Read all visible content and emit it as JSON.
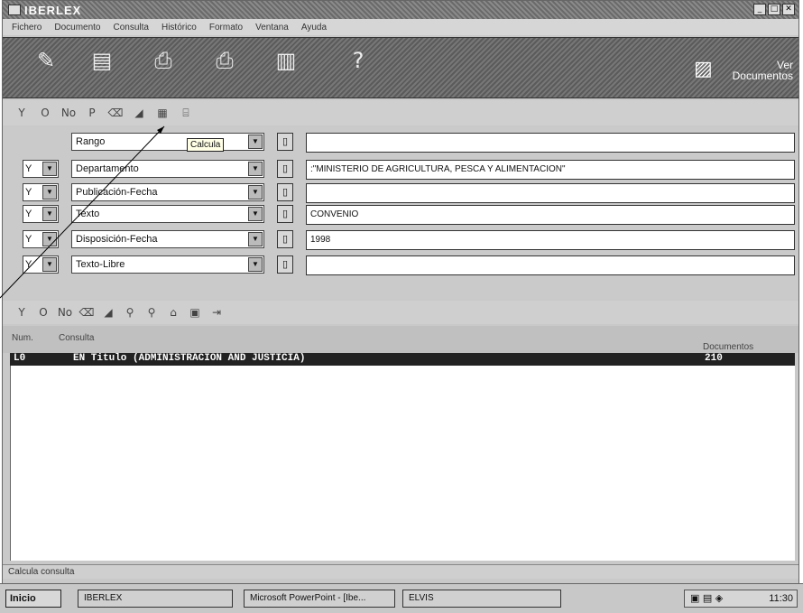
{
  "window": {
    "title": "IBERLEX",
    "buttons": [
      "_",
      "□",
      "✕"
    ]
  },
  "menu": [
    "Fichero",
    "Documento",
    "Consulta",
    "Histórico",
    "Formato",
    "Ventana",
    "Ayuda"
  ],
  "bigtoolbar": {
    "tools": [
      {
        "icon": "✎"
      },
      {
        "icon": "▤"
      },
      {
        "icon": "⎙"
      },
      {
        "icon": "⎙"
      },
      {
        "icon": "▥"
      },
      {
        "icon": "?"
      }
    ],
    "ver_documentos": "Ver\nDocumentos"
  },
  "smalltools": [
    "Y",
    "O",
    "No",
    "P",
    "⌫",
    "◢",
    "▦",
    "⌸"
  ],
  "tooltip": "Calcula",
  "rows": [
    {
      "op": "",
      "field": "Rango",
      "value": ""
    },
    {
      "op": "Y",
      "field": "Departamento",
      "value": ":\"MINISTERIO DE AGRICULTURA, PESCA Y ALIMENTACION\""
    },
    {
      "op": "Y",
      "field": "Publicación-Fecha",
      "value": ""
    },
    {
      "op": "Y",
      "field": "Texto",
      "value": "CONVENIO"
    },
    {
      "op": "Y",
      "field": "Disposición-Fecha",
      "value": "1998"
    },
    {
      "op": "Y",
      "field": "Texto-Libre",
      "value": ""
    }
  ],
  "smalltools2": [
    "Y",
    "O",
    "No",
    "⌫",
    "◢",
    "⚲",
    "⚲",
    "⌂",
    "▣",
    "⇥"
  ],
  "list": {
    "headers": {
      "num": "Num.",
      "query": "Consulta",
      "docs": "Documentos"
    },
    "selected": {
      "num": "L0",
      "query": "EN Titulo (ADMINISTRACION AND JUSTICIA)",
      "docs": "210"
    }
  },
  "status": "Calcula consulta",
  "taskbar": {
    "start": "Inicio",
    "tasks": [
      "IBERLEX",
      "Microsoft PowerPoint - [Ibe...",
      "ELVIS"
    ],
    "clock": "11:30"
  }
}
